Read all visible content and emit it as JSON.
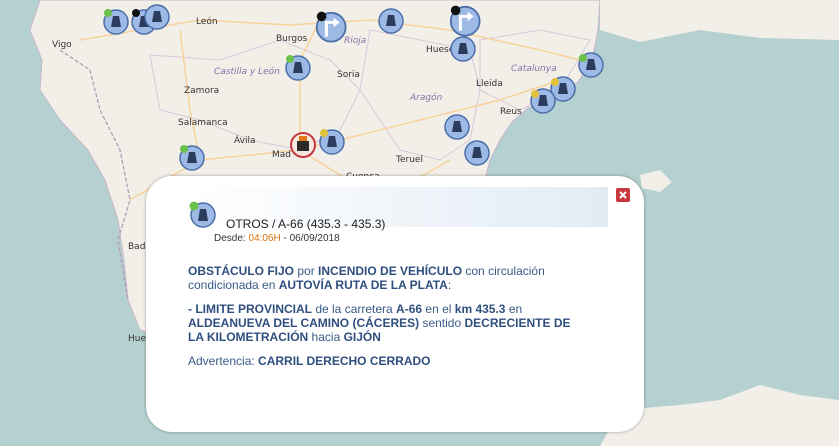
{
  "map": {
    "cities": {
      "vigo": "Vigo",
      "leon": "León",
      "burgos": "Burgos",
      "huesca": "Huesca",
      "zamora": "Zamora",
      "soria": "Soria",
      "lleida": "Lleida",
      "salamanca": "Salamanca",
      "reus": "Reus",
      "avila": "Ávila",
      "madrid": "Mad",
      "teruel": "Teruel",
      "badajoz": "Bada",
      "huelva": "Hue",
      "cuenca": "Cuenca",
      "rioja": "Rioja"
    },
    "regions": {
      "castilla_leon": "Castilla y León",
      "aragon": "Aragón",
      "catalunya": "Catalunya"
    }
  },
  "popup": {
    "category": "OTROS",
    "separator": " / ",
    "road_range": "A-66 (435.3 - 435.3)",
    "since_label": "Desde: ",
    "time": "04:06H",
    "date_sep": " - ",
    "date": "06/09/2018",
    "p1": {
      "t1": "OBSTÁCULO FIJO",
      "t2": " por ",
      "t3": "INCENDIO DE VEHÍCULO",
      "t4": " con circulación condicionada en ",
      "t5": "AUTOVÍA RUTA DE LA PLATA",
      "t6": ":"
    },
    "p2": {
      "t1": "- LIMITE PROVINCIAL",
      "t2": " de la carretera ",
      "road": "A-66",
      "t3": " en el ",
      "km": "km 435.3",
      "t4": " en ",
      "place": "ALDEANUEVA DEL CAMINO (CÁCERES)",
      "t5": " sentido ",
      "direction": "DECRECIENTE DE LA KILOMETRACIÓN",
      "t6": " hacia ",
      "dest": "GIJÓN"
    },
    "p3": {
      "label": "Advertencia: ",
      "value": "CARRIL DERECHO CERRADO"
    }
  },
  "colors": {
    "sea": "#b5d0d0",
    "land": "#f2efe9",
    "marker_blue": "#8fb0e0",
    "close_red": "#c8373d",
    "highlight_orange": "#d97413"
  }
}
